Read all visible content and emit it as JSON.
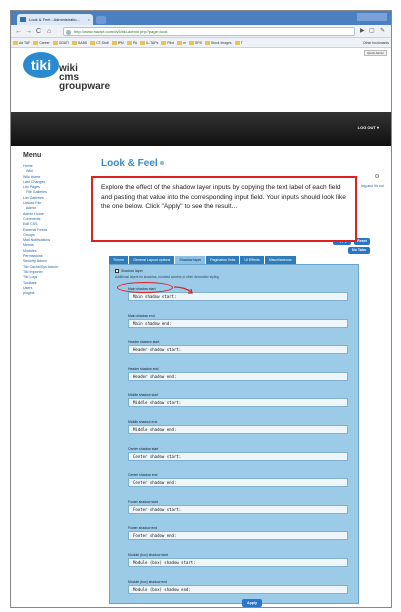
{
  "browser": {
    "tab_title": "Look & Feel : Administratio...",
    "tab_close": "×",
    "url": "http://www.nactpt.com/dv5/tiki-admin.php?page=look",
    "nav": {
      "back": "←",
      "forward": "→",
      "reload": "C",
      "home": "⌂"
    },
    "bookmarks": [
      "Ad TAF",
      "Career",
      "GDATI",
      "SABS",
      "CT-Stuff",
      "IPM",
      "PA",
      "IL-TAPs",
      "Pilot",
      "m",
      "SPS",
      "Stock Images",
      "T"
    ],
    "other_bookmarks": "Other bookmarks"
  },
  "site": {
    "quick_admin": "Quick Admin",
    "logo_mark": "tiki",
    "logo_lines": [
      "wiki",
      "cms",
      "groupware"
    ],
    "logout": "LOG OUT ▾"
  },
  "menu": {
    "title": "Menu",
    "items": [
      {
        "label": "Home",
        "sub": false
      },
      {
        "label": "Wiki",
        "sub": true
      },
      {
        "label": "Wiki Home",
        "sub": false
      },
      {
        "label": "Last Changes",
        "sub": false
      },
      {
        "label": "List Pages",
        "sub": false
      },
      {
        "label": "File Galleries",
        "sub": true
      },
      {
        "label": "List Galleries",
        "sub": false
      },
      {
        "label": "Upload File",
        "sub": false
      },
      {
        "label": "Admin",
        "sub": true
      },
      {
        "label": "Admin Home",
        "sub": false
      },
      {
        "label": "Comments",
        "sub": false
      },
      {
        "label": "Edit CSS",
        "sub": false
      },
      {
        "label": "External Feeds",
        "sub": false
      },
      {
        "label": "Groups",
        "sub": false
      },
      {
        "label": "Mail Notifications",
        "sub": false
      },
      {
        "label": "Menus",
        "sub": false
      },
      {
        "label": "Modules",
        "sub": false
      },
      {
        "label": "Permissions",
        "sub": false
      },
      {
        "label": "Security Admin",
        "sub": false
      },
      {
        "label": "Tiki Cache/Sys Admin",
        "sub": false
      },
      {
        "label": "Tiki Importer",
        "sub": false
      },
      {
        "label": "Tiki Logs",
        "sub": false
      },
      {
        "label": "Toolbars",
        "sub": false
      },
      {
        "label": "Users",
        "sub": false
      },
      {
        "label": "plugins",
        "sub": false
      }
    ]
  },
  "main": {
    "page_title": "Look & Feel",
    "callout": "Explore the effect of the shadow layer inputs by copying the text label of each field and pasting that value into the corresponding input field.  Your inputs should look like the one below.  Click \"Apply\" to see the result…",
    "right_link": "ting and it's not",
    "apply_label": "Apply",
    "reset_label": "Reset",
    "no_tabs_label": "No Tabs",
    "tabs": [
      {
        "label": "Theme",
        "active": false
      },
      {
        "label": "General Layout options",
        "active": false
      },
      {
        "label": "Shadow layer",
        "active": true
      },
      {
        "label": "Pagination links",
        "active": false
      },
      {
        "label": "UI Effects",
        "active": false
      },
      {
        "label": "Miscellaneous",
        "active": false
      }
    ],
    "shadow_checkbox_label": "Shadow layer",
    "shadow_note": "Additional layers for shadows, rounded corners or other decorative styling",
    "fields": [
      {
        "label": "Main shadow start",
        "value": "Main shadow start:"
      },
      {
        "label": "Main shadow end",
        "value": "Main shadow end:"
      },
      {
        "label": "Header shadow start",
        "value": "Header shadow start:"
      },
      {
        "label": "Header shadow end",
        "value": "Header shadow end:"
      },
      {
        "label": "Middle shadow start",
        "value": "Middle shadow start:"
      },
      {
        "label": "Middle shadow end",
        "value": "Middle shadow end:"
      },
      {
        "label": "Center shadow start",
        "value": "Center shadow start:"
      },
      {
        "label": "Center shadow end",
        "value": "Center shadow end:"
      },
      {
        "label": "Footer shadow start",
        "value": "Footer shadow start:"
      },
      {
        "label": "Footer shadow end",
        "value": "Footer shadow end:"
      },
      {
        "label": "Module (box) shadow start",
        "value": "Module (box) shadow start:"
      },
      {
        "label": "Module (box) shadow end",
        "value": "Module (box) shadow end:"
      }
    ],
    "bottom_apply_label": "Apply"
  },
  "colors": {
    "callout_border": "#dd2222",
    "panel_bg": "#9ccbe8",
    "accent": "#3a8bc6",
    "tab_bg": "#2f7cb8"
  }
}
